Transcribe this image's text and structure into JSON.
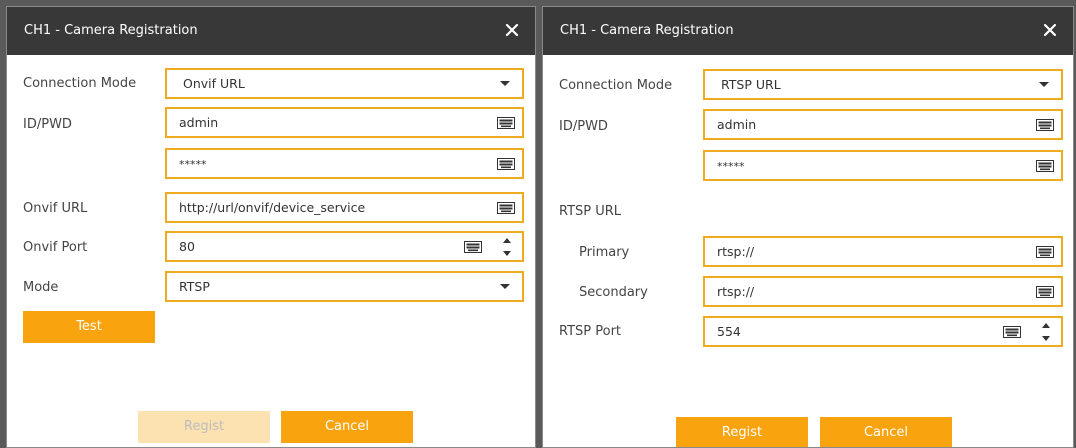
{
  "left_dialog": {
    "title": "CH1 - Camera Registration",
    "close_glyph": "×",
    "connection_mode": {
      "label": "Connection Mode",
      "value": "Onvif URL"
    },
    "id_pwd": {
      "label": "ID/PWD",
      "id_value": "admin",
      "pwd_value": "*****"
    },
    "onvif_url": {
      "label": "Onvif URL",
      "value": "http://url/onvif/device_service"
    },
    "onvif_port": {
      "label": "Onvif Port",
      "value": "80"
    },
    "mode": {
      "label": "Mode",
      "value": "RTSP"
    },
    "test_label": "Test",
    "regist_label": "Regist",
    "regist_enabled": false,
    "cancel_label": "Cancel"
  },
  "right_dialog": {
    "title": "CH1 - Camera Registration",
    "close_glyph": "×",
    "connection_mode": {
      "label": "Connection Mode",
      "value": "RTSP URL"
    },
    "id_pwd": {
      "label": "ID/PWD",
      "id_value": "admin",
      "pwd_value": "*****"
    },
    "rtsp_url": {
      "label": "RTSP URL",
      "primary_label": "Primary",
      "primary_value": "rtsp://",
      "secondary_label": "Secondary",
      "secondary_value": "rtsp://"
    },
    "rtsp_port": {
      "label": "RTSP Port",
      "value": "554"
    },
    "regist_label": "Regist",
    "regist_enabled": true,
    "cancel_label": "Cancel"
  },
  "colors": {
    "title_bar": "#383838",
    "accent": "#f9a30f",
    "field_border": "#f0aa1e",
    "disabled_button": "#fce1b1"
  },
  "icons": {
    "close": "close-icon",
    "keyboard": "keyboard-icon",
    "dropdown": "chevron-down-icon",
    "spinner": "spinner-arrows-icon"
  }
}
